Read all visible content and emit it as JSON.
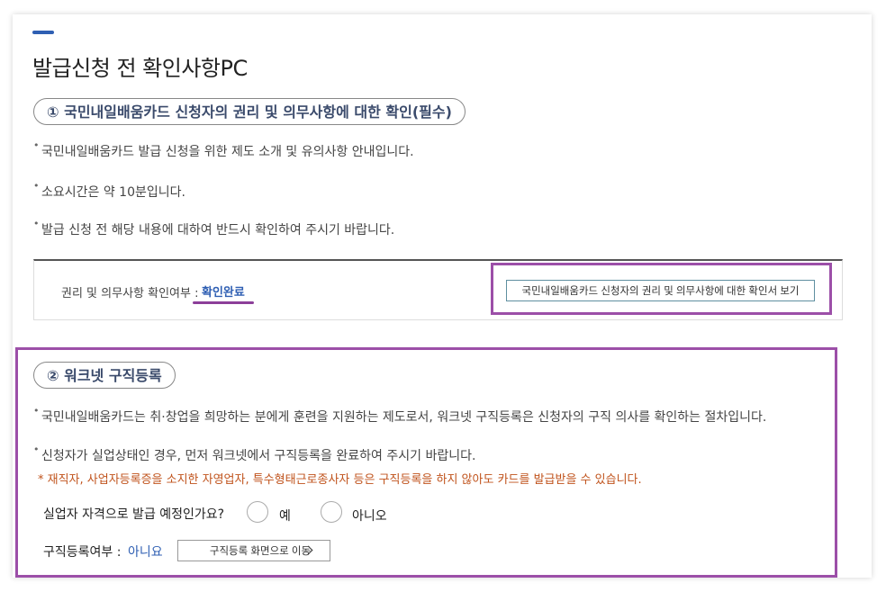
{
  "page": {
    "title": "발급신청 전 확인사항PC"
  },
  "section1": {
    "heading": "① 국민내일배움카드 신청자의 권리 및 의무사항에 대한 확인(필수)",
    "bullets": [
      "국민내일배움카드 발급 신청을 위한 제도 소개 및 유의사항 안내입니다.",
      "소요시간은 약 10분입니다.",
      "발급 신청 전 해당 내용에 대하여 반드시 확인하여 주시기 바랍니다."
    ],
    "confirm_label": "권리 및 의무사항 확인여부 :",
    "confirm_status": "확인완료",
    "view_button": "국민내일배움카드 신청자의 권리 및 의무사항에 대한 확인서 보기"
  },
  "section2": {
    "heading": "② 워크넷 구직등록",
    "bullets": [
      "국민내일배움카드는 취·창업을 희망하는 분에게 훈련을 지원하는 제도로서, 워크넷 구직등록은 신청자의 구직 의사를 확인하는 절차입니다.",
      "신청자가 실업상태인 경우, 먼저 워크넷에서 구직등록을 완료하여 주시기 바랍니다."
    ],
    "note": "* 재직자, 사업자등록증을 소지한 자영업자, 특수형태근로종사자 등은 구직등록을 하지 않아도 카드를 발급받을 수 있습니다.",
    "question": "실업자 자격으로 발급 예정인가요?",
    "options": [
      "예",
      "아니오"
    ],
    "reg_label": "구직등록여부 :",
    "reg_status": "아니요",
    "reg_button": "구직등록 화면으로 이동"
  },
  "colors": {
    "accent": "#2f5fb3",
    "highlight": "#9c4fa8",
    "note": "#c0531c"
  }
}
